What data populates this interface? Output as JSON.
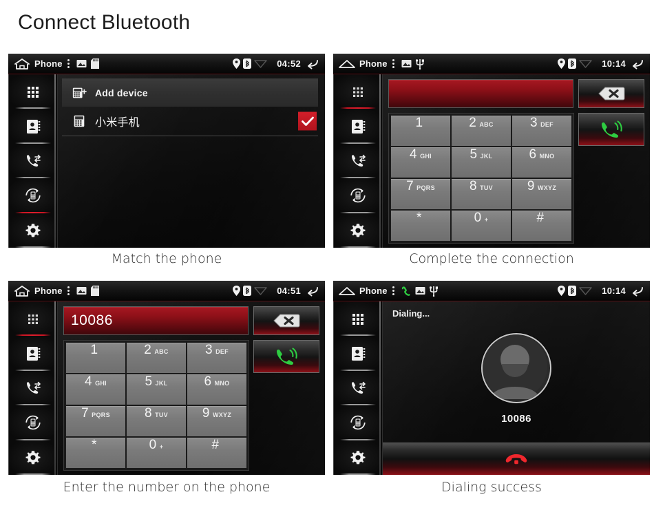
{
  "page": {
    "title": "Connect Bluetooth"
  },
  "panels": [
    {
      "id": "match-the-phone",
      "caption": "Match the phone",
      "statusbar": {
        "home_icon": "house-outline-icon",
        "title": "Phone",
        "menu_icon": "kebab-menu-icon",
        "left_icons": [
          "picture-icon",
          "sd-card-icon"
        ],
        "right_icons": [
          "location-pin-icon",
          "bluetooth-icon",
          "wifi-icon"
        ],
        "time": "04:52",
        "back_icon": "back-arrow-icon"
      },
      "sidebar": {
        "items": [
          {
            "name": "dialpad",
            "icon": "dialpad-icon",
            "active": false
          },
          {
            "name": "contacts",
            "icon": "contacts-book-icon",
            "active": false
          },
          {
            "name": "call-log",
            "icon": "call-log-icon",
            "active": false
          },
          {
            "name": "sync-device",
            "icon": "sync-device-icon",
            "active": true
          },
          {
            "name": "settings",
            "icon": "gear-icon",
            "active": false
          }
        ]
      },
      "device_list": {
        "add_row": {
          "icon": "add-device-icon",
          "label": "Add device"
        },
        "devices": [
          {
            "icon": "phone-device-icon",
            "label": "小米手机",
            "connected": true,
            "check_icon": "checkmark-icon",
            "check_color": "#c81d27"
          }
        ]
      }
    },
    {
      "id": "complete-the-connection",
      "caption": "Complete the connection",
      "statusbar": {
        "home_icon": "roof-home-icon",
        "title": "Phone",
        "menu_icon": "kebab-menu-icon",
        "left_icons": [
          "picture-icon",
          "usb-icon"
        ],
        "right_icons": [
          "location-pin-icon",
          "bluetooth-icon",
          "wifi-icon"
        ],
        "time": "10:14",
        "back_icon": "back-arrow-icon"
      },
      "sidebar": {
        "items": [
          {
            "name": "dialpad",
            "icon": "dialpad-icon",
            "active": true
          },
          {
            "name": "contacts",
            "icon": "contacts-book-icon",
            "active": false
          },
          {
            "name": "call-log",
            "icon": "call-log-icon",
            "active": false
          },
          {
            "name": "sync-device",
            "icon": "sync-device-icon",
            "active": false
          },
          {
            "name": "settings",
            "icon": "gear-icon",
            "active": false
          }
        ]
      },
      "dialer": {
        "number_value": "",
        "number_placeholder": "",
        "backspace_icon": "backspace-icon",
        "call_icon": "call-green-icon",
        "keys": [
          {
            "digit": "1",
            "letters": ""
          },
          {
            "digit": "2",
            "letters": "ABC"
          },
          {
            "digit": "3",
            "letters": "DEF"
          },
          {
            "digit": "4",
            "letters": "GHI"
          },
          {
            "digit": "5",
            "letters": "JKL"
          },
          {
            "digit": "6",
            "letters": "MNO"
          },
          {
            "digit": "7",
            "letters": "PQRS"
          },
          {
            "digit": "8",
            "letters": "TUV"
          },
          {
            "digit": "9",
            "letters": "WXYZ"
          },
          {
            "digit": "*",
            "letters": ""
          },
          {
            "digit": "0",
            "letters": "+"
          },
          {
            "digit": "#",
            "letters": ""
          }
        ]
      }
    },
    {
      "id": "enter-the-number",
      "caption": "Enter the number on the phone",
      "statusbar": {
        "home_icon": "house-outline-icon",
        "title": "Phone",
        "menu_icon": "kebab-menu-icon",
        "left_icons": [
          "picture-icon",
          "sd-card-icon"
        ],
        "right_icons": [
          "location-pin-icon",
          "bluetooth-icon",
          "wifi-icon"
        ],
        "time": "04:51",
        "back_icon": "back-arrow-icon"
      },
      "sidebar": {
        "items": [
          {
            "name": "dialpad",
            "icon": "dialpad-icon",
            "active": true
          },
          {
            "name": "contacts",
            "icon": "contacts-book-icon",
            "active": false
          },
          {
            "name": "call-log",
            "icon": "call-log-icon",
            "active": false
          },
          {
            "name": "sync-device",
            "icon": "sync-device-icon",
            "active": false
          },
          {
            "name": "settings",
            "icon": "gear-icon",
            "active": false
          }
        ]
      },
      "dialer": {
        "number_value": "10086",
        "number_placeholder": "",
        "backspace_icon": "backspace-icon",
        "call_icon": "call-green-icon",
        "keys": [
          {
            "digit": "1",
            "letters": ""
          },
          {
            "digit": "2",
            "letters": "ABC"
          },
          {
            "digit": "3",
            "letters": "DEF"
          },
          {
            "digit": "4",
            "letters": "GHI"
          },
          {
            "digit": "5",
            "letters": "JKL"
          },
          {
            "digit": "6",
            "letters": "MNO"
          },
          {
            "digit": "7",
            "letters": "PQRS"
          },
          {
            "digit": "8",
            "letters": "TUV"
          },
          {
            "digit": "9",
            "letters": "WXYZ"
          },
          {
            "digit": "*",
            "letters": ""
          },
          {
            "digit": "0",
            "letters": "+"
          },
          {
            "digit": "#",
            "letters": ""
          }
        ]
      }
    },
    {
      "id": "dialing-success",
      "caption": "Dialing success",
      "statusbar": {
        "home_icon": "roof-home-icon",
        "title": "Phone",
        "menu_icon": "kebab-menu-icon",
        "left_icons": [
          "call-green-icon",
          "picture-icon",
          "usb-icon"
        ],
        "right_icons": [
          "location-pin-icon",
          "bluetooth-icon",
          "wifi-icon"
        ],
        "time": "10:14",
        "back_icon": "back-arrow-icon"
      },
      "sidebar": {
        "items": [
          {
            "name": "dialpad",
            "icon": "dialpad-icon",
            "active": false
          },
          {
            "name": "contacts",
            "icon": "contacts-book-icon",
            "active": false
          },
          {
            "name": "call-log",
            "icon": "call-log-icon",
            "active": false
          },
          {
            "name": "sync-device",
            "icon": "sync-device-icon",
            "active": false
          },
          {
            "name": "settings",
            "icon": "gear-icon",
            "active": false
          }
        ]
      },
      "call": {
        "status_text": "Dialing...",
        "avatar_icon": "person-avatar-icon",
        "number": "10086",
        "hangup_icon": "hangup-red-icon"
      }
    }
  ],
  "colors": {
    "accent_red": "#c81d27",
    "call_green": "#2ecc41",
    "screen_black": "#0b0b0b",
    "key_gray": "#7b7b7b"
  }
}
